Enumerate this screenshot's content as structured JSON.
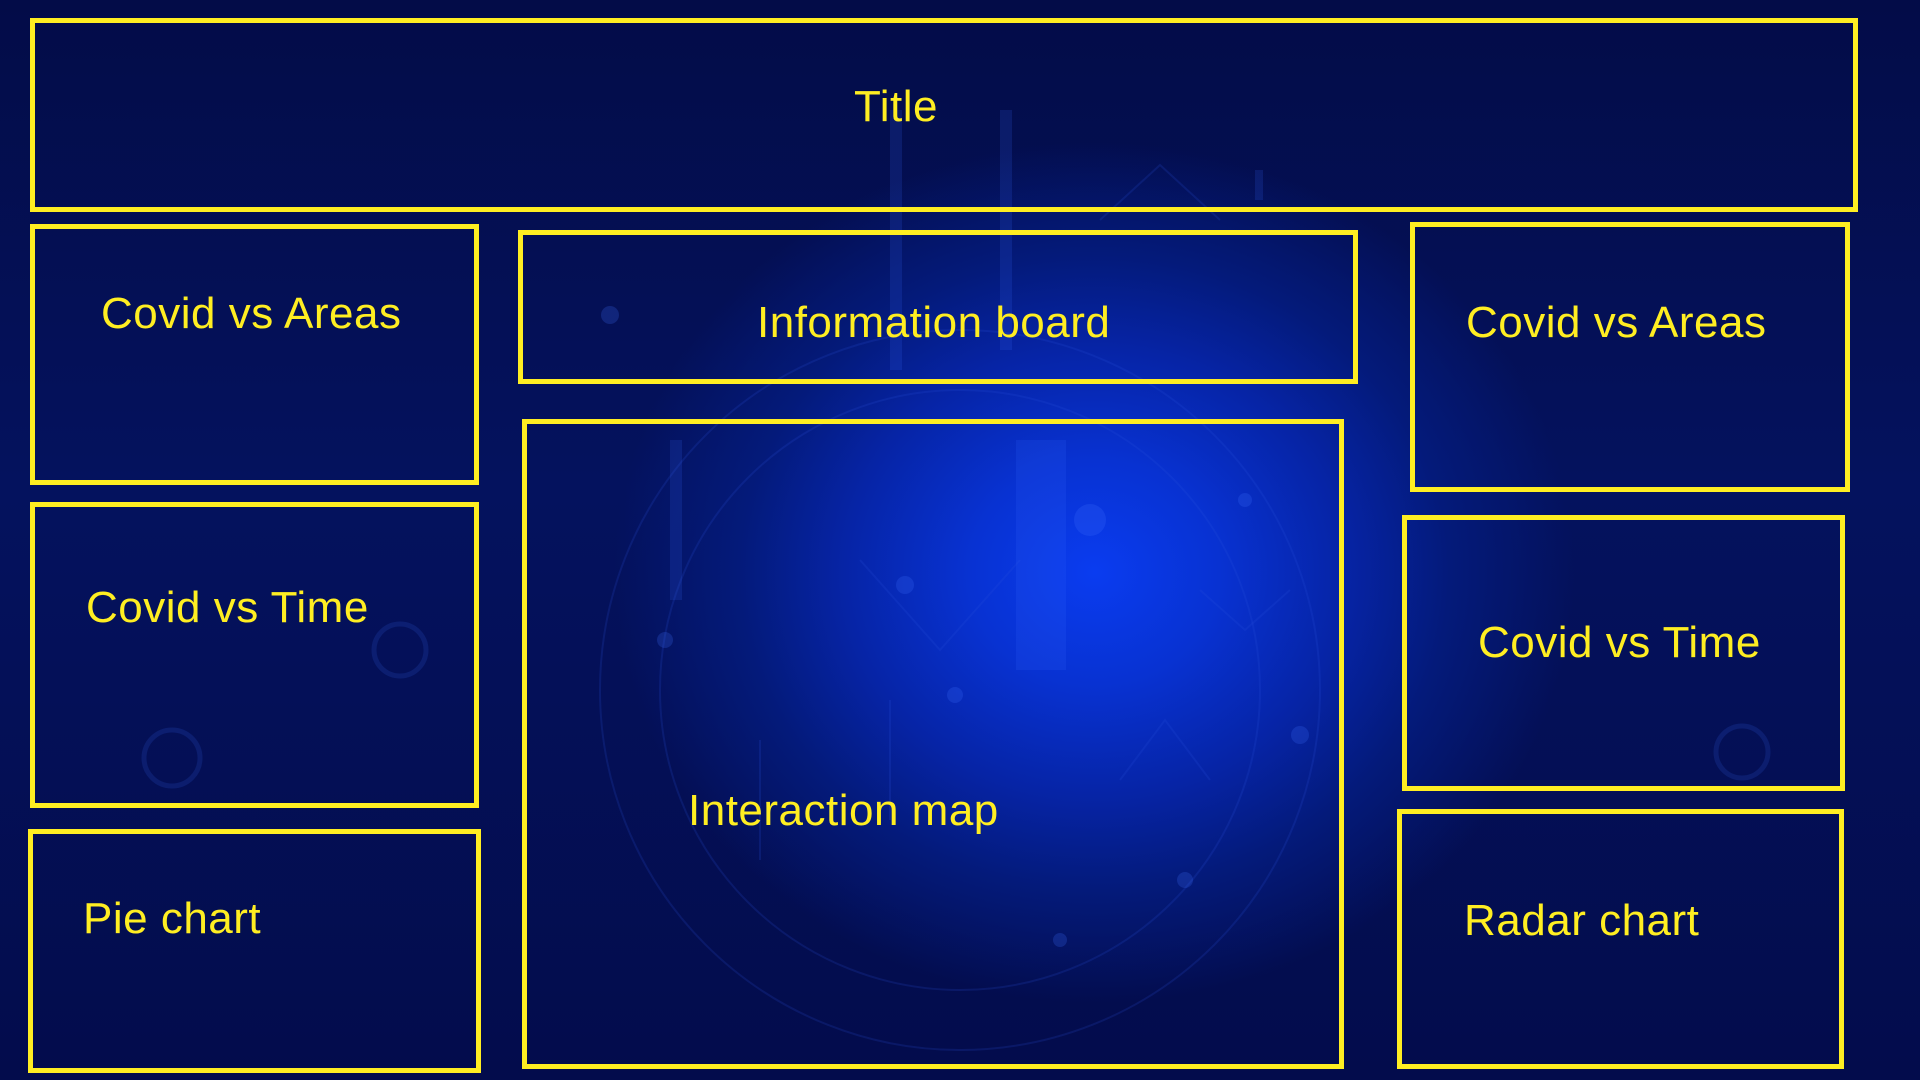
{
  "colors": {
    "panel_border": "#ffee22",
    "label_text": "#ffee22",
    "background_dark": "#030c48",
    "background_glow": "#0a3cf0"
  },
  "panels": {
    "title": "Title",
    "info_board": "Information board",
    "left_areas": "Covid vs Areas",
    "left_time": "Covid vs Time",
    "pie": "Pie chart",
    "map": "Interaction map",
    "right_areas": "Covid vs Areas",
    "right_time": "Covid vs Time",
    "radar": "Radar chart"
  }
}
